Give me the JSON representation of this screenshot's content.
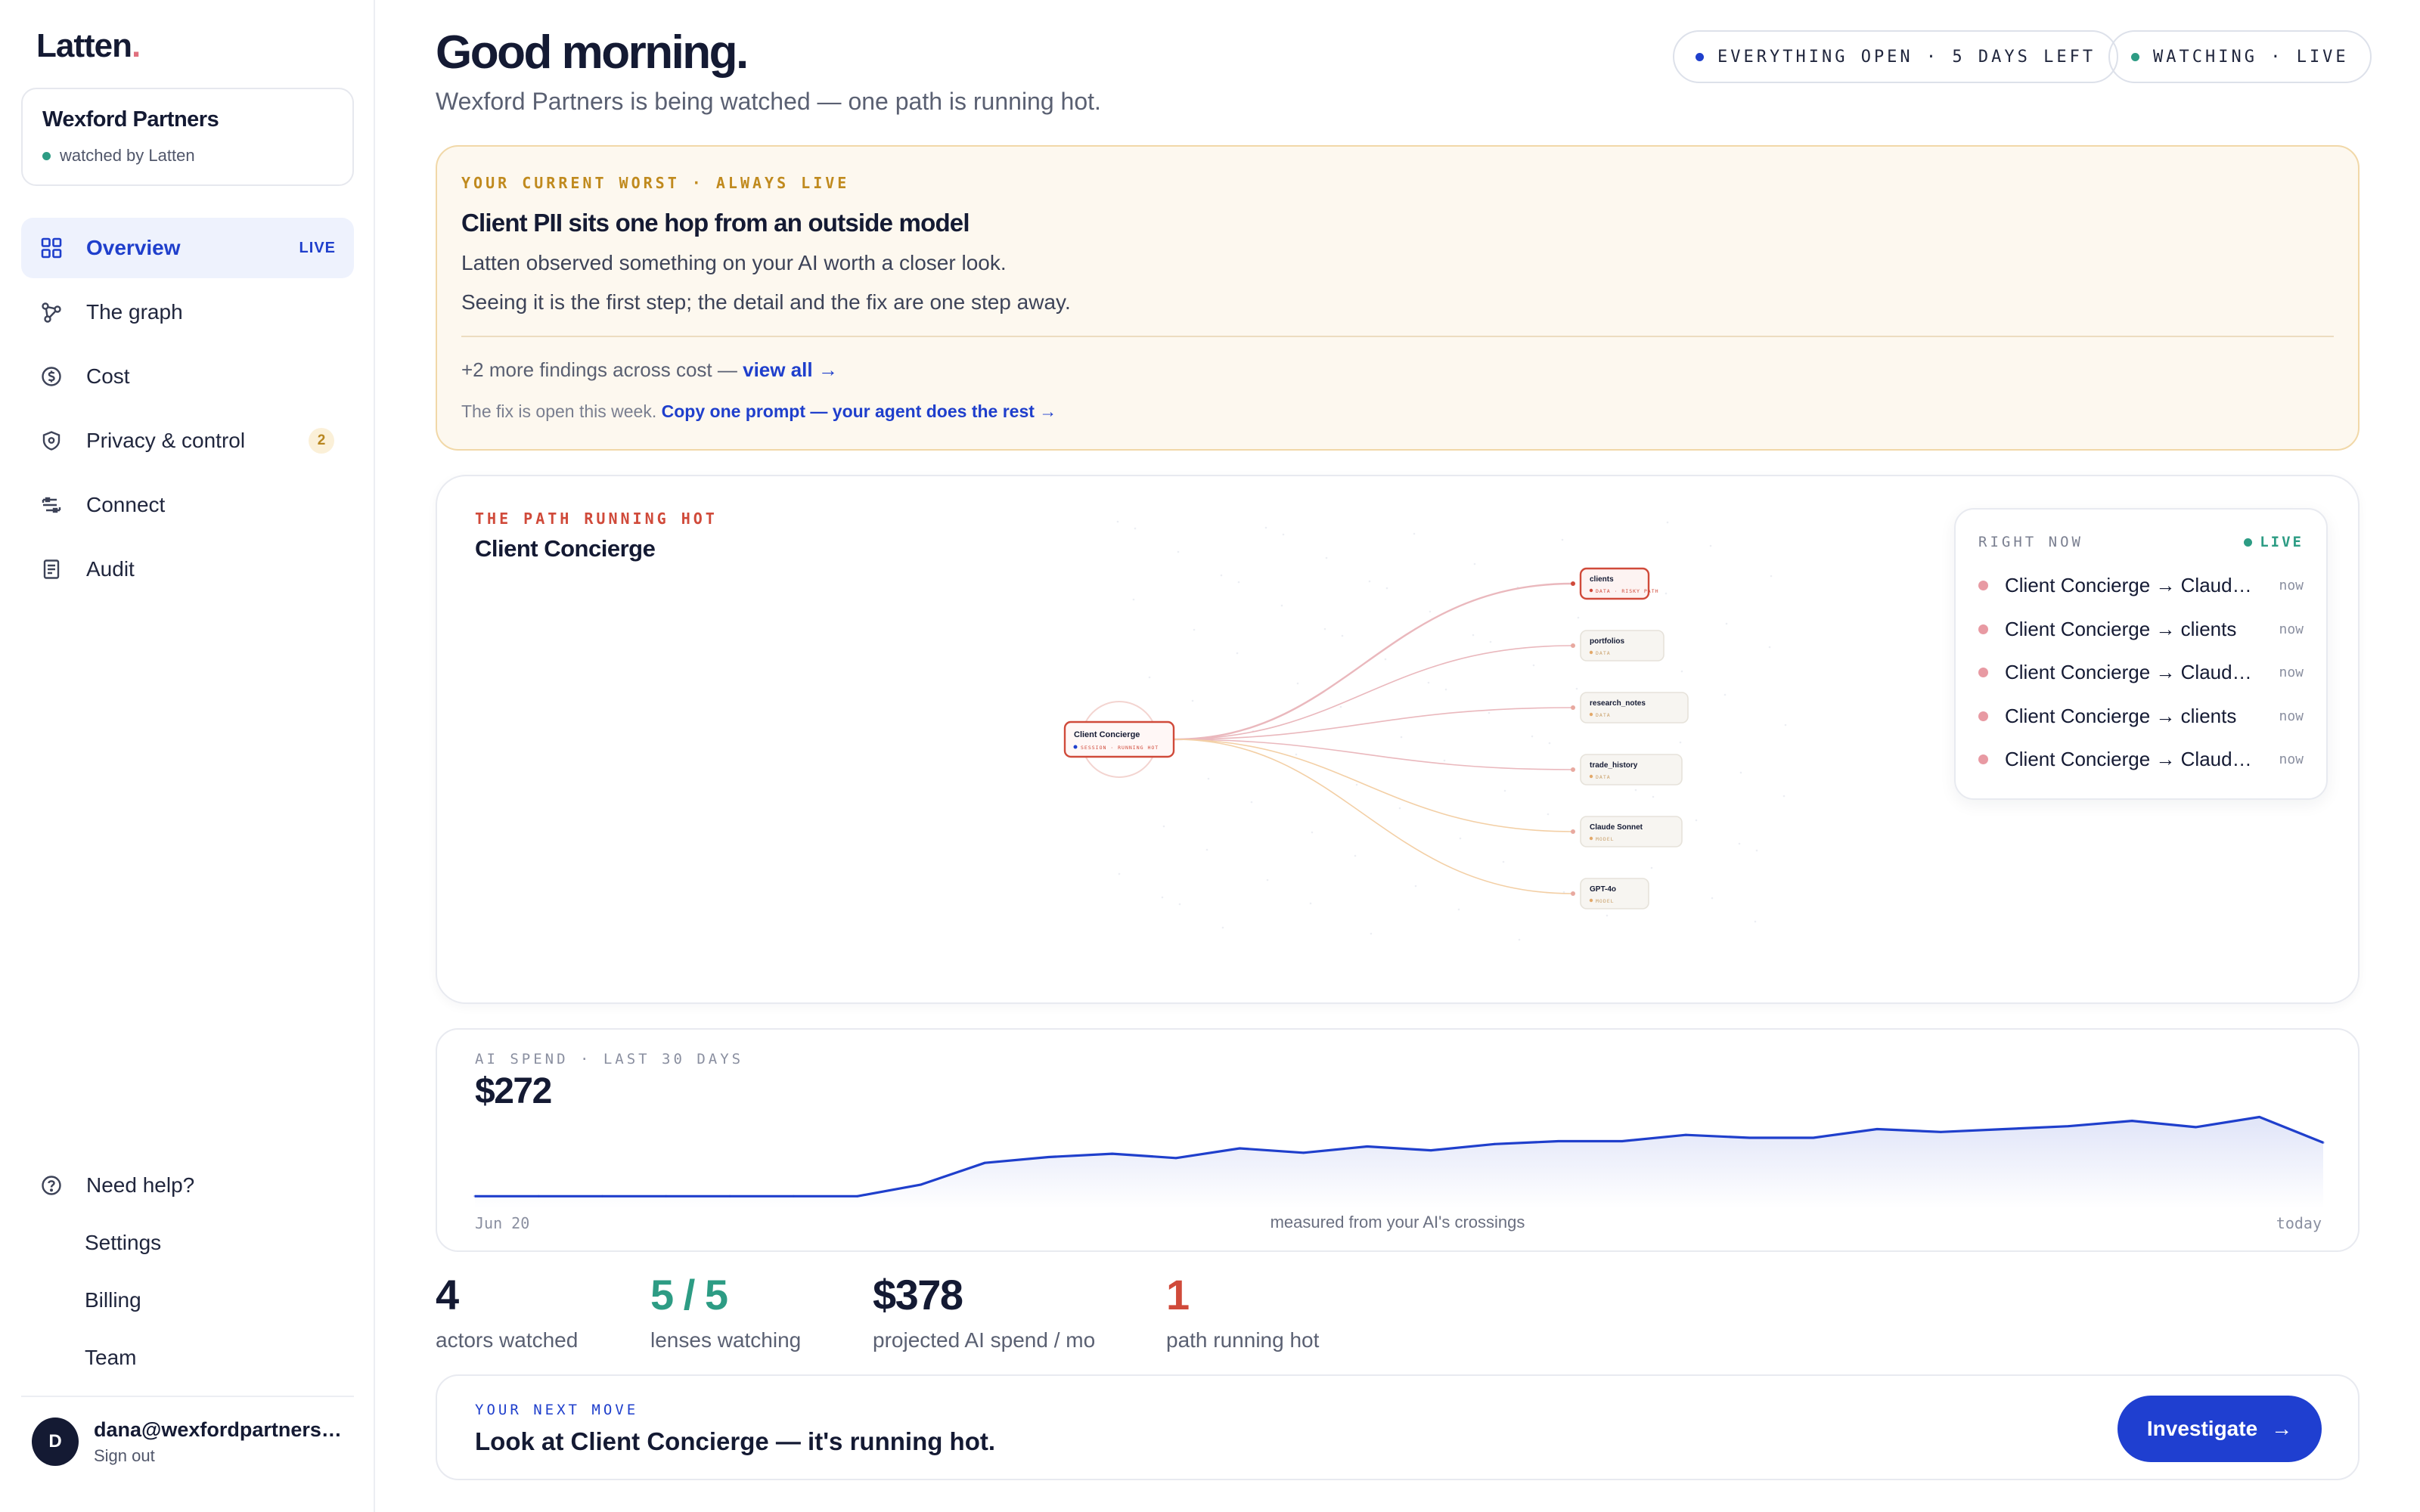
{
  "app": {
    "logo": "Latten",
    "logo_dot": "."
  },
  "org": {
    "name": "Wexford Partners",
    "status": "watched by Latten"
  },
  "nav": [
    {
      "label": "Overview",
      "icon": "grid-icon",
      "tag": "LIVE"
    },
    {
      "label": "The graph",
      "icon": "graph-icon"
    },
    {
      "label": "Cost",
      "icon": "dollar-circle-icon"
    },
    {
      "label": "Privacy & control",
      "icon": "shield-icon",
      "badge": "2"
    },
    {
      "label": "Connect",
      "icon": "connect-icon"
    },
    {
      "label": "Audit",
      "icon": "document-icon"
    }
  ],
  "help": {
    "need_help": "Need help?",
    "settings": "Settings",
    "billing": "Billing",
    "team": "Team"
  },
  "user": {
    "initial": "D",
    "email": "dana@wexfordpartners.com",
    "sign_out": "Sign out"
  },
  "header": {
    "greeting": "Good morning.",
    "subtitle": "Wexford Partners is being watched — one path is running hot.",
    "pill_trial": "EVERYTHING OPEN · 5 DAYS LEFT",
    "pill_watch": "WATCHING · LIVE"
  },
  "worst": {
    "eyebrow": "YOUR CURRENT WORST · ALWAYS LIVE",
    "title": "Client PII sits one hop from an outside model",
    "line1": "Latten observed something on your AI worth a closer look.",
    "line2": "Seeing it is the first step; the detail and the fix are one step away.",
    "more_text": "+2 more findings across cost — ",
    "more_link": "view all →",
    "fix_text": "The fix is open this week. ",
    "fix_link": "Copy one prompt — your agent does the rest →"
  },
  "path": {
    "eyebrow": "THE PATH RUNNING HOT",
    "title": "Client Concierge",
    "graph": {
      "source": {
        "label": "Client Concierge",
        "sub": "SESSION · RUNNING HOT"
      },
      "targets": [
        {
          "label": "clients",
          "sub": "DATA · RISKY PATH",
          "hot": true
        },
        {
          "label": "portfolios",
          "sub": "DATA"
        },
        {
          "label": "research_notes",
          "sub": "DATA"
        },
        {
          "label": "trade_history",
          "sub": "DATA"
        },
        {
          "label": "Claude Sonnet",
          "sub": "MODEL"
        },
        {
          "label": "GPT-4o",
          "sub": "MODEL"
        }
      ]
    },
    "right_now": {
      "label": "RIGHT NOW",
      "live": "LIVE",
      "rows": [
        {
          "text": "Client Concierge → Claude Sonnet",
          "when": "now"
        },
        {
          "text": "Client Concierge → clients",
          "when": "now"
        },
        {
          "text": "Client Concierge → Claude Sonnet",
          "when": "now"
        },
        {
          "text": "Client Concierge → clients",
          "when": "now"
        },
        {
          "text": "Client Concierge → Claude Sonnet",
          "when": "now"
        }
      ]
    }
  },
  "spend": {
    "eyebrow": "AI SPEND · LAST 30 DAYS",
    "total": "$272",
    "start_label": "Jun 20",
    "mid_label": "measured from your AI's crossings",
    "end_label": "today",
    "accent": "#1f3fcc"
  },
  "chart_data": {
    "type": "area",
    "title": "AI SPEND · LAST 30 DAYS",
    "x": [
      "Jun 20",
      "",
      "",
      "",
      "",
      "",
      "",
      "",
      "",
      "",
      "",
      "",
      "",
      "",
      "",
      "",
      "",
      "",
      "",
      "",
      "",
      "",
      "",
      "",
      "",
      "",
      "",
      "",
      "",
      "today"
    ],
    "values": [
      0.9,
      0.9,
      0.9,
      0.9,
      0.9,
      0.9,
      0.9,
      3.3,
      7.8,
      9.0,
      9.7,
      8.8,
      10.8,
      9.9,
      11.2,
      10.4,
      11.7,
      12.3,
      12.3,
      13.6,
      13.0,
      13.0,
      14.8,
      14.2,
      14.8,
      15.4,
      16.5,
      15.2,
      17.3,
      12.0
    ],
    "xlabel": "measured from your AI's crossings",
    "ylabel": "",
    "grid": false
  },
  "stats": [
    {
      "value": "4",
      "label": "actors watched",
      "color": "#141a33"
    },
    {
      "value": "5 / 5",
      "label": "lenses watching",
      "color": "#2d9c84"
    },
    {
      "value": "$378",
      "label": "projected AI spend / mo",
      "color": "#141a33"
    },
    {
      "value": "1",
      "label": "path running hot",
      "color": "#d04a3a"
    }
  ],
  "next": {
    "eyebrow": "YOUR NEXT MOVE",
    "text": "Look at Client Concierge — it's running hot.",
    "button": "Investigate",
    "button_arrow": "→"
  }
}
